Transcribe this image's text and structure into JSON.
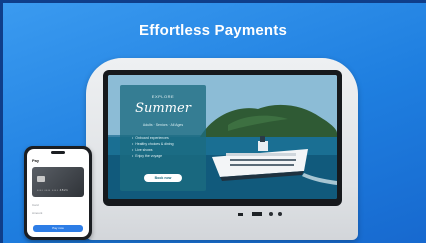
{
  "headline": "Effortless Payments",
  "screen": {
    "brand_text": "EXPLORE",
    "title": "Summer",
    "subline": "Adults · Seniors · All Ages",
    "features": [
      "Onboard experiences",
      "Healthy choices & dining",
      "Live shows",
      "Enjoy the voyage"
    ],
    "cta_label": "Book now"
  },
  "phone": {
    "heading": "Pay",
    "card_number": "•••• •••• •••• 4821",
    "row1": "Card",
    "row2": "Amount",
    "pay_label": "Pay now"
  },
  "colors": {
    "background": "#2a8be8",
    "accent": "#2d7de6",
    "card_overlay": "#1c6c80"
  }
}
